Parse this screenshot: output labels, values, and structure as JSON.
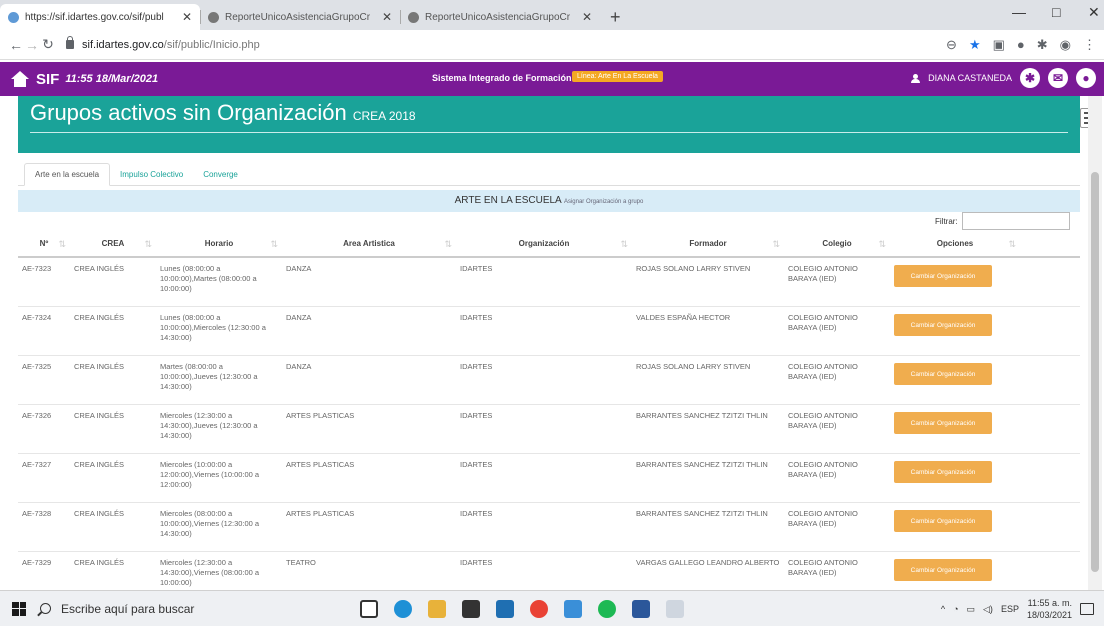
{
  "browser": {
    "tabs": [
      {
        "title": "https://sif.idartes.gov.co/sif/publ",
        "icon": "globe-icon",
        "active": true
      },
      {
        "title": "ReporteUnicoAsistenciaGrupoCr",
        "icon": "chrome-icon",
        "active": false
      },
      {
        "title": "ReporteUnicoAsistenciaGrupoCr",
        "icon": "chrome-icon",
        "active": false
      }
    ],
    "url_host": "sif.idartes.gov.co",
    "url_path": "/sif/public/Inicio.php"
  },
  "app": {
    "brand": "SIF",
    "datetime": "11:55 18/Mar/2021",
    "system_title": "Sistema Integrado de Formación",
    "system_badge": "Línea: Arte En La Escuela",
    "user_name": "DIANA CASTANEDA",
    "accent_color": "#7a1a96",
    "banner_color": "#1aa399"
  },
  "page": {
    "title": "Grupos activos sin Organización",
    "subtitle": "CREA 2018",
    "tabs": [
      "Arte en la escuela",
      "Impulso Colectivo",
      "Converge"
    ],
    "section_title": "ARTE EN LA ESCUELA",
    "section_subtitle": "Asignar Organización a grupo",
    "filter_label": "Filtrar:"
  },
  "table": {
    "columns": [
      "Nº",
      "CREA",
      "Horario",
      "Area Artistica",
      "Organización",
      "Formador",
      "Colegio",
      "Opciones"
    ],
    "rows": [
      {
        "id": "AE-7323",
        "crea": "CREA INGLÉS",
        "horario": "Lunes (08:00:00 a 10:00:00),Martes (08:00:00 a 10:00:00)",
        "area": "DANZA",
        "org": "IDARTES",
        "formador": "ROJAS SOLANO LARRY STIVEN",
        "colegio": "COLEGIO ANTONIO BARAYA (IED)",
        "action": "Cambiar Organización"
      },
      {
        "id": "AE-7324",
        "crea": "CREA INGLÉS",
        "horario": "Lunes (08:00:00 a 10:00:00),Miercoles (12:30:00 a 14:30:00)",
        "area": "DANZA",
        "org": "IDARTES",
        "formador": "VALDES ESPAÑA HECTOR",
        "colegio": "COLEGIO ANTONIO BARAYA (IED)",
        "action": "Cambiar Organización"
      },
      {
        "id": "AE-7325",
        "crea": "CREA INGLÉS",
        "horario": "Martes (08:00:00 a 10:00:00),Jueves (12:30:00 a 14:30:00)",
        "area": "DANZA",
        "org": "IDARTES",
        "formador": "ROJAS SOLANO LARRY STIVEN",
        "colegio": "COLEGIO ANTONIO BARAYA (IED)",
        "action": "Cambiar Organización"
      },
      {
        "id": "AE-7326",
        "crea": "CREA INGLÉS",
        "horario": "Miercoles (12:30:00 a 14:30:00),Jueves (12:30:00 a 14:30:00)",
        "area": "ARTES PLASTICAS",
        "org": "IDARTES",
        "formador": "BARRANTES SANCHEZ TZITZI THLIN",
        "colegio": "COLEGIO ANTONIO BARAYA (IED)",
        "action": "Cambiar Organización"
      },
      {
        "id": "AE-7327",
        "crea": "CREA INGLÉS",
        "horario": "Miercoles (10:00:00 a 12:00:00),Viernes (10:00:00 a 12:00:00)",
        "area": "ARTES PLASTICAS",
        "org": "IDARTES",
        "formador": "BARRANTES SANCHEZ TZITZI THLIN",
        "colegio": "COLEGIO ANTONIO BARAYA (IED)",
        "action": "Cambiar Organización"
      },
      {
        "id": "AE-7328",
        "crea": "CREA INGLÉS",
        "horario": "Miercoles (08:00:00 a 10:00:00),Viernes (12:30:00 a 14:30:00)",
        "area": "ARTES PLASTICAS",
        "org": "IDARTES",
        "formador": "BARRANTES SANCHEZ TZITZI THLIN",
        "colegio": "COLEGIO ANTONIO BARAYA (IED)",
        "action": "Cambiar Organización"
      },
      {
        "id": "AE-7329",
        "crea": "CREA INGLÉS",
        "horario": "Miercoles (12:30:00 a 14:30:00),Viernes (08:00:00 a 10:00:00)",
        "area": "TEATRO",
        "org": "IDARTES",
        "formador": "VARGAS GALLEGO LEANDRO ALBERTO",
        "colegio": "COLEGIO ANTONIO BARAYA (IED)",
        "action": "Cambiar Organización"
      }
    ]
  },
  "taskbar": {
    "search_placeholder": "Escribe aquí para buscar",
    "lang": "ESP",
    "time": "11:55 a. m.",
    "date": "18/03/2021"
  }
}
